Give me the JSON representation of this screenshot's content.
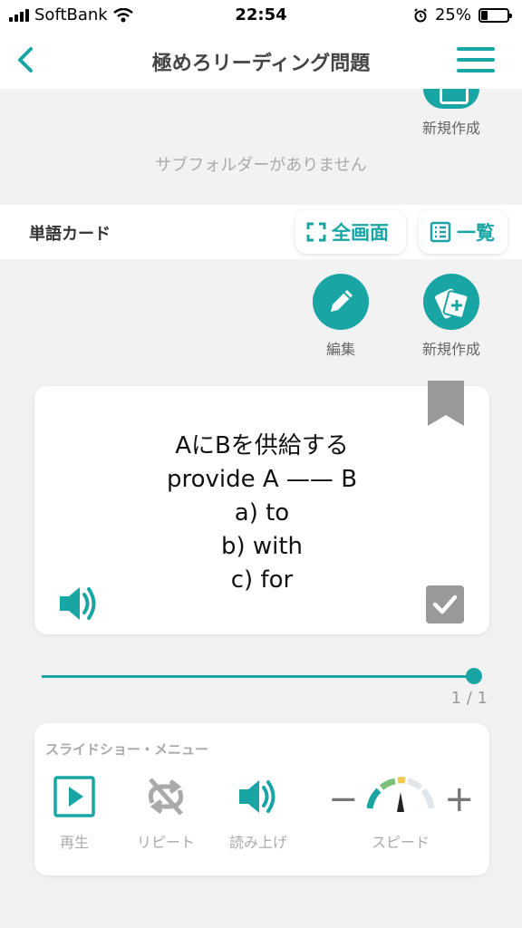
{
  "status": {
    "carrier": "SoftBank",
    "time": "22:54",
    "battery": "25%",
    "battery_level": 0.25
  },
  "nav": {
    "title": "極めろリーディング問題"
  },
  "folder": {
    "new_label": "新規作成",
    "empty_message": "サブフォルダーがありません"
  },
  "cards": {
    "section_title": "単語カード",
    "fullscreen_label": "全画面",
    "list_label": "一覧",
    "edit_label": "編集",
    "new_label": "新規作成"
  },
  "flashcard": {
    "line1": "AにBを供給する",
    "line2": "provide A —— B",
    "line3": "a)  to",
    "line4": "b)  with",
    "line5": "c)  for"
  },
  "progress": {
    "label": "1 / 1",
    "position": 1
  },
  "slideshow": {
    "title": "スライドショー・メニュー",
    "play_label": "再生",
    "repeat_label": "リピート",
    "read_label": "読み上げ",
    "speed_label": "スピード",
    "minus": "−",
    "plus": "+"
  },
  "colors": {
    "accent": "#1aa5a5",
    "inactive": "#aaaaaa",
    "gauge_green": "#7cc07c",
    "gauge_yellow": "#f2c94c"
  }
}
